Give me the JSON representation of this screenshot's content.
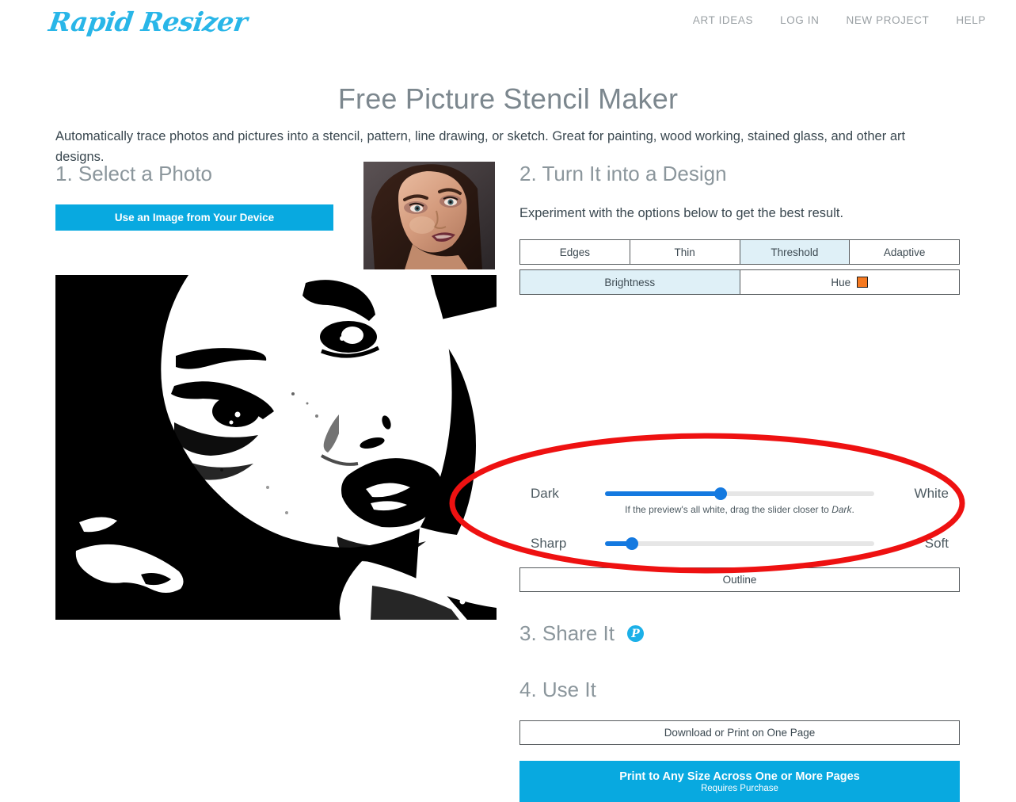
{
  "header": {
    "logo_text": "Rapid Resizer",
    "logo_color": "#29b6e8",
    "nav": [
      {
        "label": "ART IDEAS"
      },
      {
        "label": "LOG IN"
      },
      {
        "label": "NEW PROJECT"
      },
      {
        "label": "HELP"
      }
    ]
  },
  "page": {
    "title": "Free Picture Stencil Maker",
    "description": "Automatically trace photos and pictures into a stencil, pattern, line drawing, or sketch. Great for painting, wood working, stained glass, and other art designs."
  },
  "step1": {
    "heading": "1. Select a Photo",
    "upload_button": "Use an Image from Your Device"
  },
  "step2": {
    "heading": "2. Turn It into a Design",
    "subtext": "Experiment with the options below to get the best result.",
    "mode_tabs": [
      {
        "label": "Edges",
        "selected": false
      },
      {
        "label": "Thin",
        "selected": false
      },
      {
        "label": "Threshold",
        "selected": true
      },
      {
        "label": "Adaptive",
        "selected": false
      }
    ],
    "channel_tabs": [
      {
        "label": "Brightness",
        "selected": true
      },
      {
        "label": "Hue",
        "selected": false,
        "swatch_color": "#f57920"
      }
    ],
    "brightness_slider": {
      "left_label": "Dark",
      "right_label": "White",
      "value_percent": 43
    },
    "slider_hint_prefix": "If the preview's all white, drag the slider closer to ",
    "slider_hint_emphasis": "Dark",
    "slider_hint_suffix": ".",
    "sharpness_slider": {
      "left_label": "Sharp",
      "right_label": "Soft",
      "value_percent": 10
    },
    "outline_button": "Outline"
  },
  "step3": {
    "heading": "3. Share It",
    "pinterest_glyph": "P"
  },
  "step4": {
    "heading": "4. Use It",
    "download_button": "Download or Print on One Page",
    "print_button_main": "Print to Any Size Across One or More Pages",
    "print_button_sub": "Requires Purchase"
  },
  "annotation": {
    "shape": "ellipse",
    "color": "#ee1111",
    "stroke_width": 7
  },
  "colors": {
    "accent_blue": "#08a9e0",
    "slider_blue": "#1479e0",
    "tab_selected": "#dff0f7",
    "hue_swatch": "#f57920",
    "annotation_red": "#ee1111"
  }
}
